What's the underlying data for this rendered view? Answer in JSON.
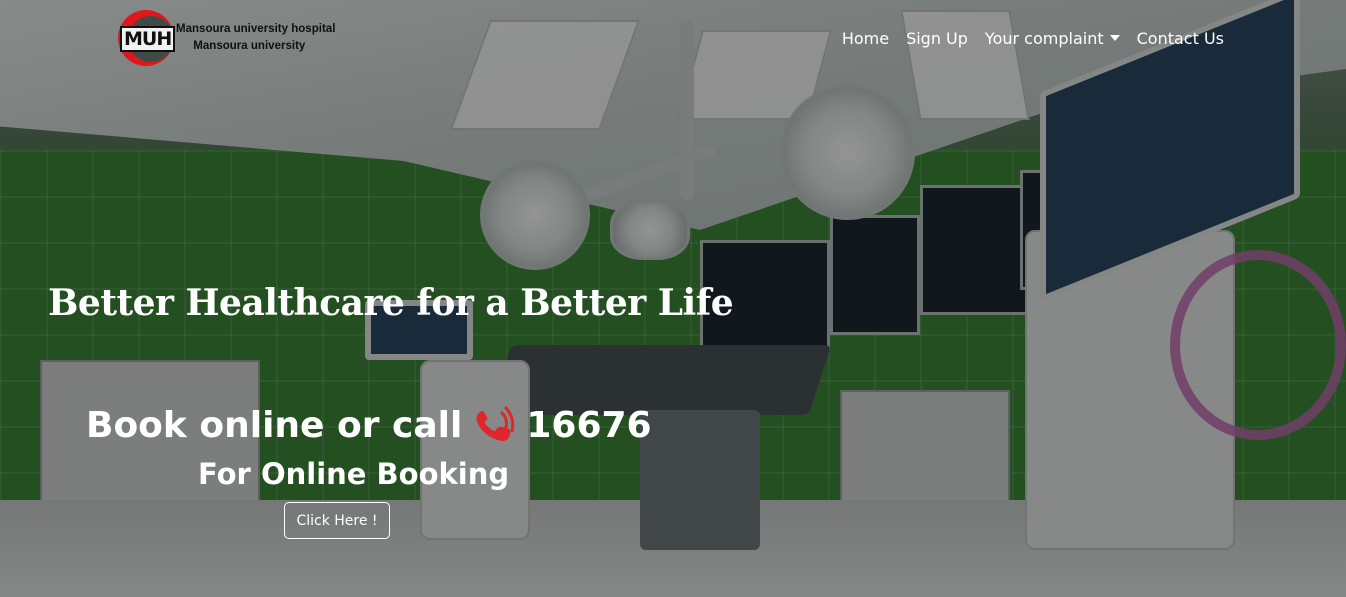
{
  "brand": {
    "logo_text": "MUH",
    "line1": "Mansoura university hospital",
    "line2": "Mansoura university",
    "accent_color": "#e1161d"
  },
  "nav": {
    "items": [
      {
        "label": "Home"
      },
      {
        "label": "Sign Up"
      },
      {
        "label": "Your complaint",
        "has_dropdown": true
      },
      {
        "label": "Contact Us"
      }
    ]
  },
  "hero": {
    "title": "Better Healthcare for a Better Life",
    "book_text": "Book online or call",
    "phone_icon": "phone-ringing-icon",
    "phone_icon_color": "#e0262a",
    "phone_number": "16676",
    "online_booking": "For Online Booking",
    "button_label": "Click Here !"
  }
}
